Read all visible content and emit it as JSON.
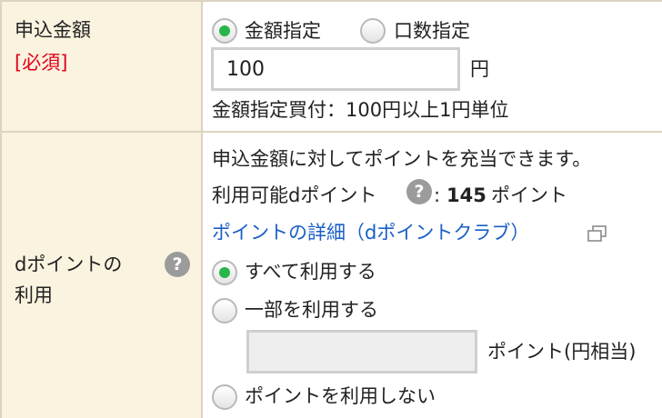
{
  "amount_section": {
    "label": "申込金額",
    "required": "[必須]",
    "option_amount": "金額指定",
    "option_units": "口数指定",
    "amount_value": "100",
    "unit": "円",
    "note": "金額指定買付：100円以上1円単位"
  },
  "point_section": {
    "label_line1": "dポイントの",
    "label_line2": "利用",
    "help_icon": "question-mark",
    "description": "申込金額に対してポイントを充当できます。",
    "available_label": "利用可能dポイント",
    "available_sep": ":",
    "available_value": "145",
    "available_unit": "ポイント",
    "detail_link": "ポイントの詳細（dポイントクラブ）",
    "option_all": "すべて利用する",
    "option_partial": "一部を利用する",
    "partial_value": "",
    "partial_unit": "ポイント(円相当)",
    "option_none": "ポイントを利用しない"
  },
  "colors": {
    "label_bg": "#faf3df",
    "border": "#dcd3c0",
    "required": "#e2001a",
    "link": "#1a5fc7",
    "radio_selected": "#28b64a"
  }
}
